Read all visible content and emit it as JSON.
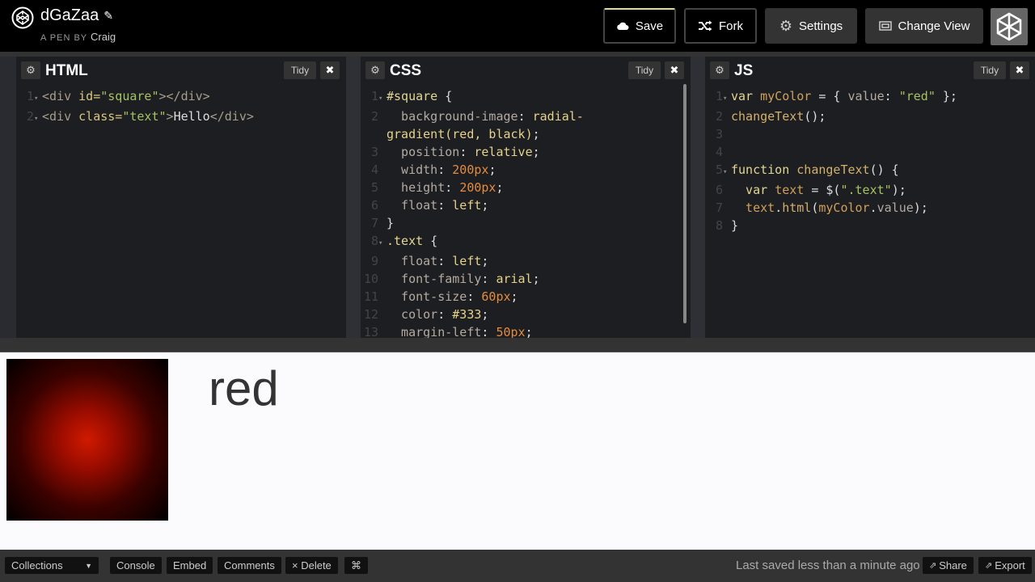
{
  "header": {
    "pen_title": "dGaZaa",
    "pen_by_prefix": "A PEN BY",
    "author": "Craig",
    "buttons": {
      "save": "Save",
      "fork": "Fork",
      "settings": "Settings",
      "change_view": "Change View"
    }
  },
  "editors": {
    "html": {
      "title": "HTML",
      "tidy": "Tidy"
    },
    "css": {
      "title": "CSS",
      "tidy": "Tidy"
    },
    "js": {
      "title": "JS",
      "tidy": "Tidy"
    }
  },
  "html_code": [
    "<div id=\"square\"></div>",
    "<div class=\"text\">Hello</div>"
  ],
  "css_code": [
    "#square {",
    "  background-image: radial-",
    "gradient(red, black);",
    "  position: relative;",
    "  width: 200px;",
    "  height: 200px;",
    "  float: left;",
    "}",
    ".text {",
    "  float: left;",
    "  font-family: arial;",
    "  font-size: 60px;",
    "  color: #333;",
    "  margin-left: 50px;"
  ],
  "js_code": [
    "var myColor = { value: \"red\" };",
    "changeText();",
    "",
    "",
    "function changeText() {",
    "  var text = $(\".text\");",
    "  text.html(myColor.value);",
    "}"
  ],
  "preview": {
    "text": "red"
  },
  "footer": {
    "collections": "Collections",
    "console": "Console",
    "embed": "Embed",
    "comments": "Comments",
    "delete": "× Delete",
    "cmd": "⌘",
    "saved_status": "Last saved less than a minute ago",
    "share": "Share",
    "export": "Export"
  },
  "icons": {
    "logo": "codepen-logo-icon",
    "edit": "pencil-icon",
    "save": "cloud-icon",
    "fork": "fork-icon",
    "settings": "gear-icon",
    "change_view": "layout-icon",
    "close": "close-icon",
    "dropdown": "chevron-down-icon",
    "share": "share-icon",
    "export": "export-icon"
  },
  "colors": {
    "preview_bg": "#fbfbfe",
    "editor_bg": "#1d1e22",
    "text_color": "#333333"
  }
}
